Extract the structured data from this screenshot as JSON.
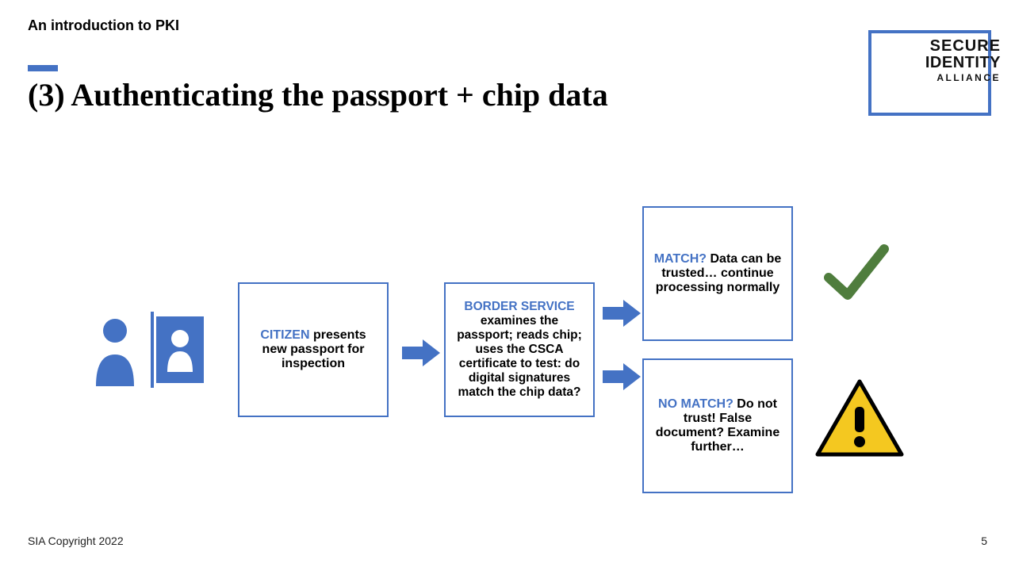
{
  "header": {
    "label": "An introduction to PKI"
  },
  "title": "(3) Authenticating the passport + chip data",
  "logo": {
    "line1": "SECURE",
    "line2": "IDENTITY",
    "line3": "ALLIANCE"
  },
  "boxes": {
    "citizen": {
      "label": "CITIZEN",
      "body": " presents new passport for inspection"
    },
    "border": {
      "label": "BORDER SERVICE",
      "body": " examines the passport; reads chip; uses the CSCA certificate to test: do digital signatures match the chip data?"
    },
    "match": {
      "label": "MATCH?",
      "body": " Data can be trusted… continue processing normally"
    },
    "nomatch": {
      "label": "NO MATCH?",
      "body": " Do not trust! False document? Examine further…"
    }
  },
  "footer": {
    "copyright": "SIA Copyright 2022",
    "page": "5"
  },
  "colors": {
    "accent": "#4472C4",
    "checkGreen": "#4F7D3D",
    "warnYellow": "#F4C820",
    "warnStroke": "#000000"
  }
}
